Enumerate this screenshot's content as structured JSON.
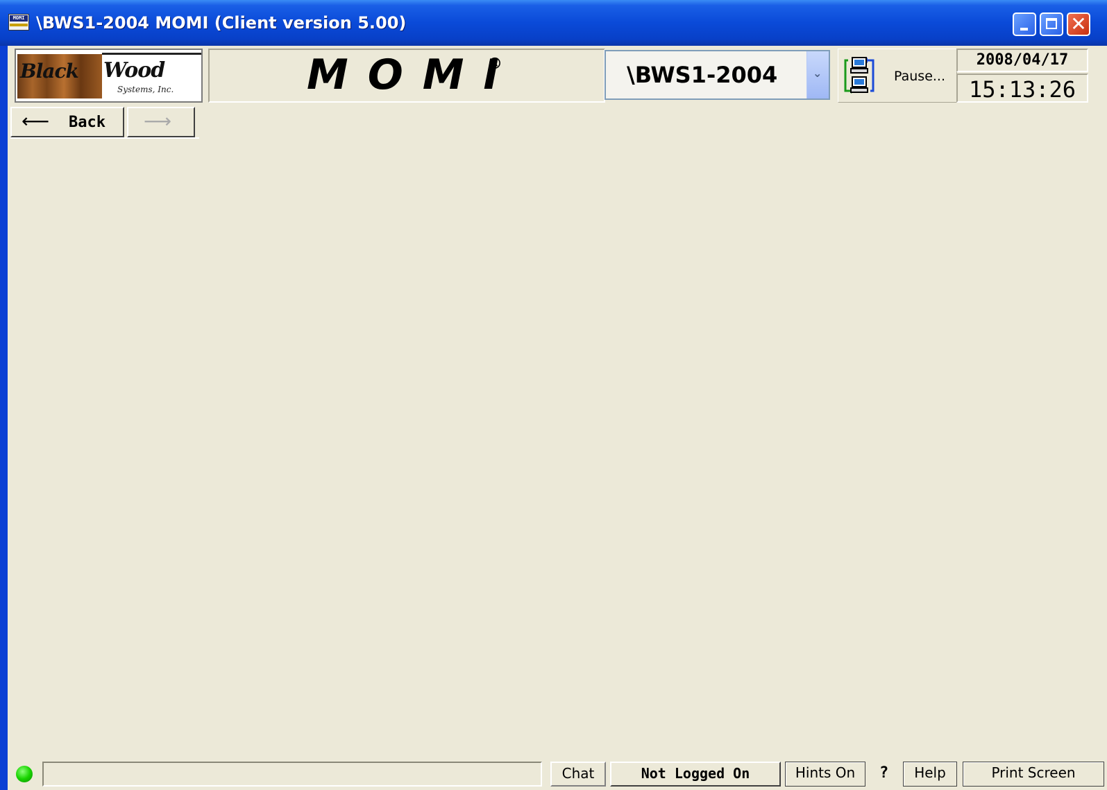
{
  "window": {
    "title": "\\BWS1-2004 MOMI (Client version 5.00)",
    "app_icon_text": "MOMI"
  },
  "header": {
    "logo": {
      "word1": "Black",
      "word2": "Wood",
      "tagline": "Systems, Inc."
    },
    "product_name": "MOMI",
    "registered_mark": "®",
    "server_select": {
      "value": "\\BWS1-2004"
    },
    "connection": {
      "label": "Pause..."
    },
    "date": "2008/04/17",
    "time": "15:13:26"
  },
  "nav": {
    "back_label": "Back"
  },
  "statusbar": {
    "led_color": "#19d400",
    "status_text": "",
    "chat_label": "Chat",
    "login_label": "Not Logged On",
    "hints_label": "Hints On",
    "question_label": "?",
    "help_label": "Help",
    "print_label": "Print Screen"
  },
  "colors": {
    "titlebar": "#0a4ad8",
    "client_bg": "#ece9d8",
    "close_button": "#c83010"
  }
}
